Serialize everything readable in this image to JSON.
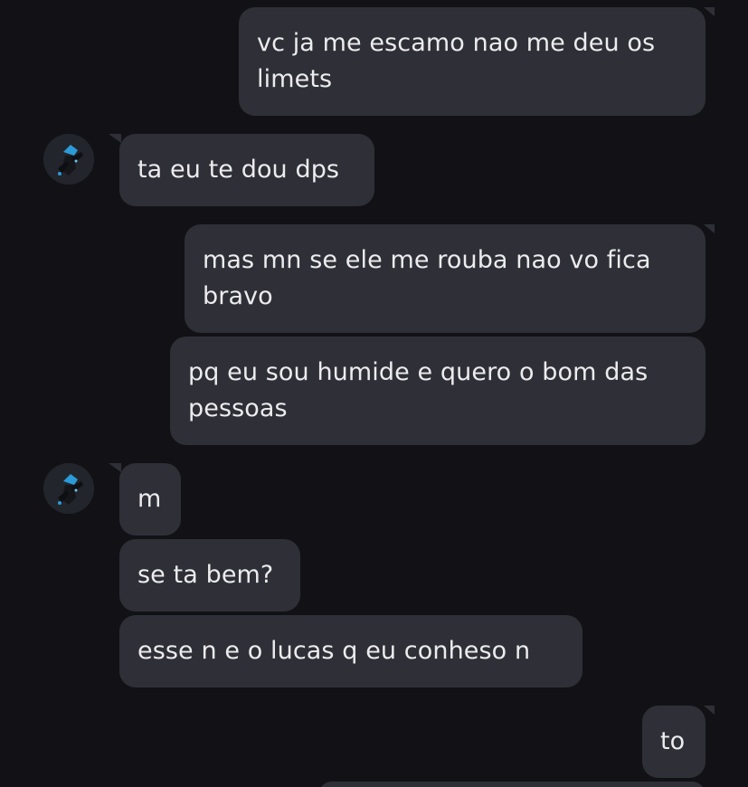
{
  "messages": [
    {
      "from": "me",
      "text": "vc ja me escamo nao me deu os\nlimets"
    },
    {
      "from": "them",
      "text": "ta eu te dou dps"
    },
    {
      "from": "me",
      "text": "mas mn se ele me rouba nao vo fica\nbravo"
    },
    {
      "from": "me",
      "text": "pq eu sou humide e quero o bom das\npessoas"
    },
    {
      "from": "them",
      "text": "m"
    },
    {
      "from": "them",
      "text": "se ta bem?"
    },
    {
      "from": "them",
      "text": "esse n e o lucas q eu conheso n"
    },
    {
      "from": "me",
      "text": "to"
    }
  ],
  "contact": {
    "avatar_icon": "character-avatar-icon"
  },
  "colors": {
    "background": "#121216",
    "bubble": "#2f2f37",
    "text": "#ececef"
  }
}
